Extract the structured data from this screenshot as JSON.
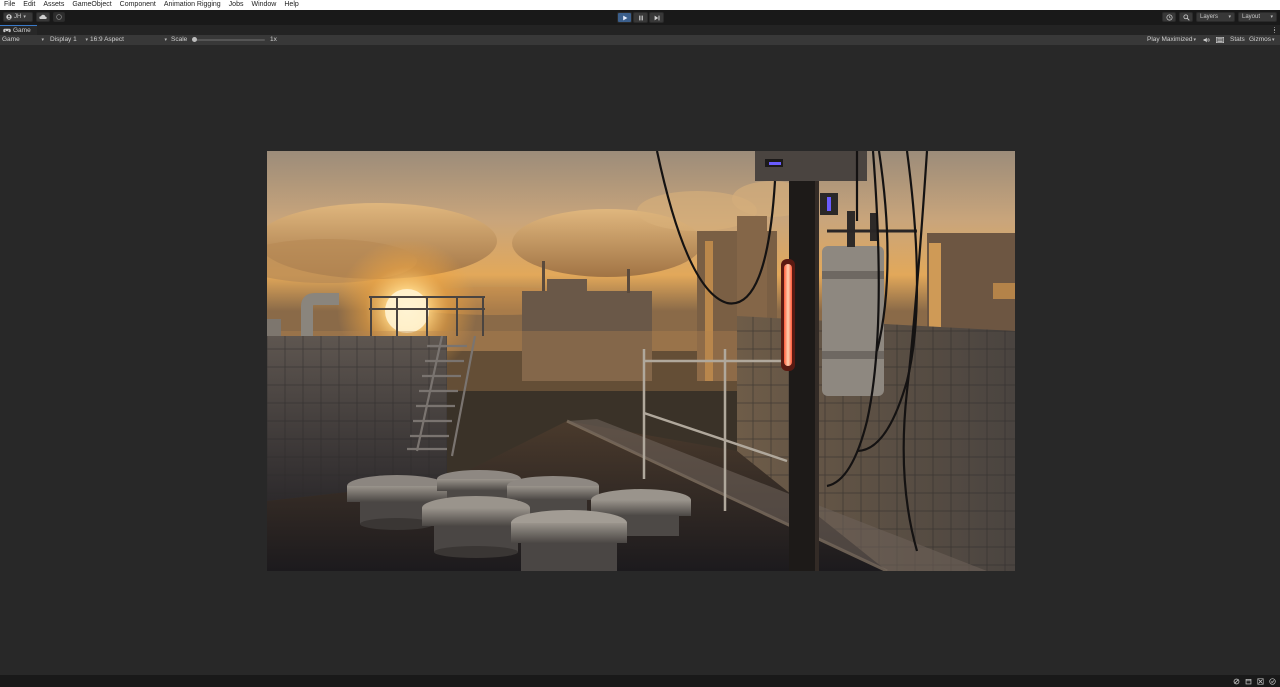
{
  "menu": {
    "items": [
      "File",
      "Edit",
      "Assets",
      "GameObject",
      "Component",
      "Animation Rigging",
      "Jobs",
      "Window",
      "Help"
    ]
  },
  "toolbar": {
    "account_label": "JH",
    "account_icon": "account-icon",
    "cloud_icon": "cloud-icon",
    "collab_icon": "collab-icon",
    "play_icon": "play-icon",
    "pause_icon": "pause-icon",
    "step_icon": "step-icon",
    "history_icon": "history-icon",
    "search_icon": "search-icon",
    "layers_label": "Layers",
    "layout_label": "Layout",
    "play_active_color": "#3b5f8c"
  },
  "tabs": {
    "game_label": "Game",
    "game_icon": "gamepad-icon"
  },
  "game_view": {
    "mode_label": "Game",
    "display_label": "Display 1",
    "aspect_label": "16:9 Aspect",
    "scale_label": "Scale",
    "scale_value": "1x",
    "scale_fraction": 0.02,
    "play_maximized_label": "Play Maximized",
    "stats_label": "Stats",
    "gizmos_label": "Gizmos",
    "mute_icon": "speaker-icon",
    "gallery_icon": "gallery-icon"
  },
  "status": {
    "icons": [
      "debug-icon",
      "package-icon",
      "network-icon",
      "check-icon"
    ]
  }
}
